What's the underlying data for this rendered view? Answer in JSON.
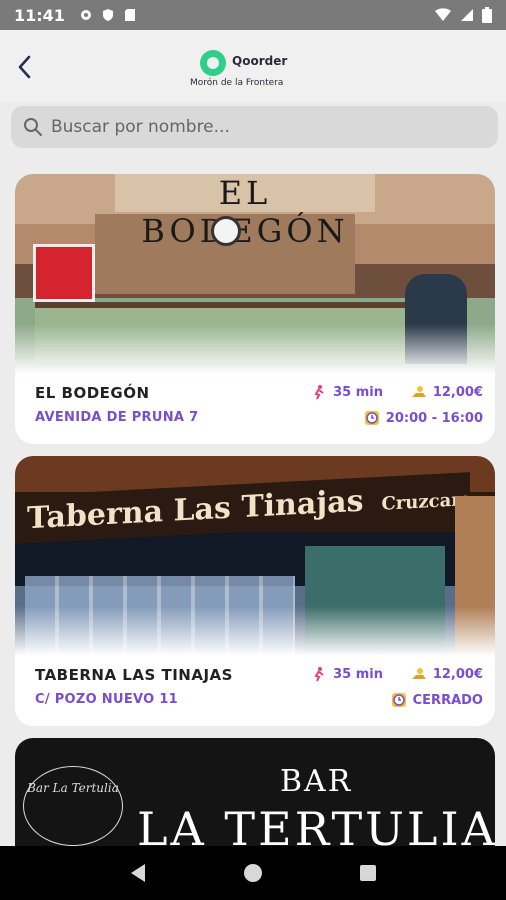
{
  "status_bar": {
    "time": "11:41",
    "left_icons": [
      "gear-icon",
      "shield-icon",
      "sdcard-icon"
    ],
    "right_icons": [
      "wifi-icon",
      "signal-icon",
      "battery-icon"
    ]
  },
  "header": {
    "brand_name": "Qoorder",
    "city": "Morón de la Frontera",
    "brand_color": "#2fcf8b"
  },
  "search": {
    "placeholder": "Buscar por nombre..."
  },
  "restaurants": [
    {
      "name": "EL BODEGÓN",
      "address": "AVENIDA DE PRUNA 7",
      "time": "35 min",
      "price": "12,00€",
      "hours": "20:00 - 16:00",
      "photo_sign": "EL BODEGÓN"
    },
    {
      "name": "TABERNA LAS TINAJAS",
      "address": "C/ POZO NUEVO 11",
      "time": "35 min",
      "price": "12,00€",
      "hours": "CERRADO",
      "photo_sign": "Taberna Las Tinajas",
      "photo_sign_extra": "Cruzcampo"
    },
    {
      "photo_sign_small": "BAR",
      "photo_sign_big": "LA TERTULIA",
      "photo_logo": "Bar La Tertulia"
    }
  ],
  "accent_color": "#7a4cd0"
}
